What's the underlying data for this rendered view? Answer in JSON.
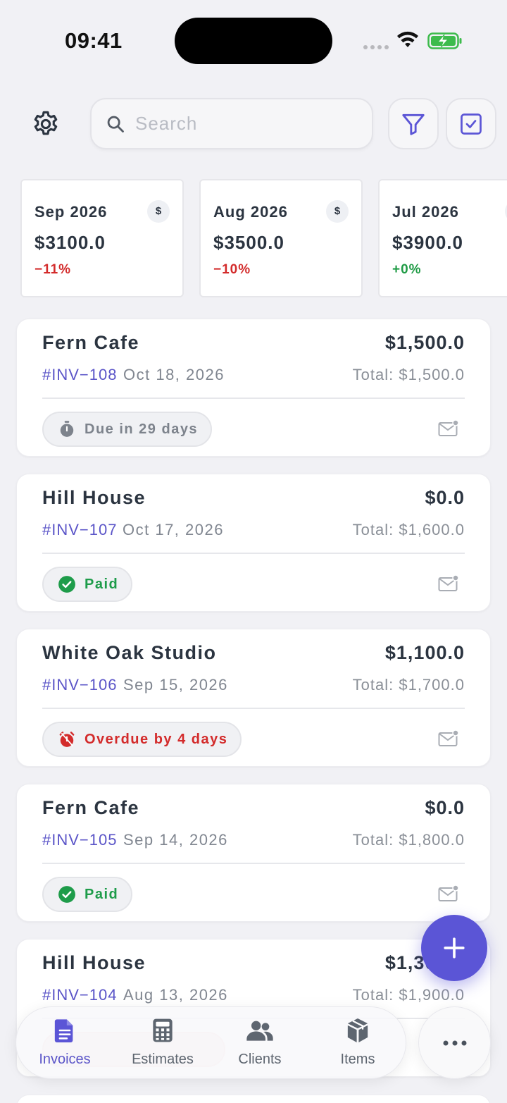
{
  "status_bar": {
    "time": "09:41"
  },
  "header": {
    "search_placeholder": "Search"
  },
  "summary": [
    {
      "month": "Sep 2026",
      "currency_symbol": "$",
      "amount": "$3100.0",
      "change": "−11%",
      "trend": "negative"
    },
    {
      "month": "Aug 2026",
      "currency_symbol": "$",
      "amount": "$3500.0",
      "change": "−10%",
      "trend": "negative"
    },
    {
      "month": "Jul 2026",
      "currency_symbol": "$",
      "amount": "$3900.0",
      "change": "+0%",
      "trend": "positive"
    }
  ],
  "invoices": [
    {
      "client": "Fern Cafe",
      "balance": "$1,500.0",
      "number": "#INV−108",
      "date": "Oct 18, 2026",
      "total": "Total: $1,500.0",
      "status": "Due in 29 days",
      "status_type": "due"
    },
    {
      "client": "Hill House",
      "balance": "$0.0",
      "number": "#INV−107",
      "date": "Oct 17, 2026",
      "total": "Total: $1,600.0",
      "status": "Paid",
      "status_type": "paid"
    },
    {
      "client": "White Oak Studio",
      "balance": "$1,100.0",
      "number": "#INV−106",
      "date": "Sep 15, 2026",
      "total": "Total: $1,700.0",
      "status": "Overdue by 4 days",
      "status_type": "overdue"
    },
    {
      "client": "Fern Cafe",
      "balance": "$0.0",
      "number": "#INV−105",
      "date": "Sep 14, 2026",
      "total": "Total: $1,800.0",
      "status": "Paid",
      "status_type": "paid"
    },
    {
      "client": "Hill House",
      "balance": "$1,300.0",
      "number": "#INV−104",
      "date": "Aug 13, 2026",
      "total": "Total: $1,900.0",
      "status": "",
      "status_type": "overdue"
    }
  ],
  "nav": {
    "items": [
      {
        "label": "Invoices",
        "icon": "document-icon",
        "active": true
      },
      {
        "label": "Estimates",
        "icon": "calculator-icon",
        "active": false
      },
      {
        "label": "Clients",
        "icon": "users-icon",
        "active": false
      },
      {
        "label": "Items",
        "icon": "box-icon",
        "active": false
      }
    ],
    "more_icon": "more-icon"
  },
  "colors": {
    "accent": "#5b55d6",
    "negative": "#d32b2b",
    "positive": "#1f9b45",
    "background": "#f1f1f5"
  }
}
